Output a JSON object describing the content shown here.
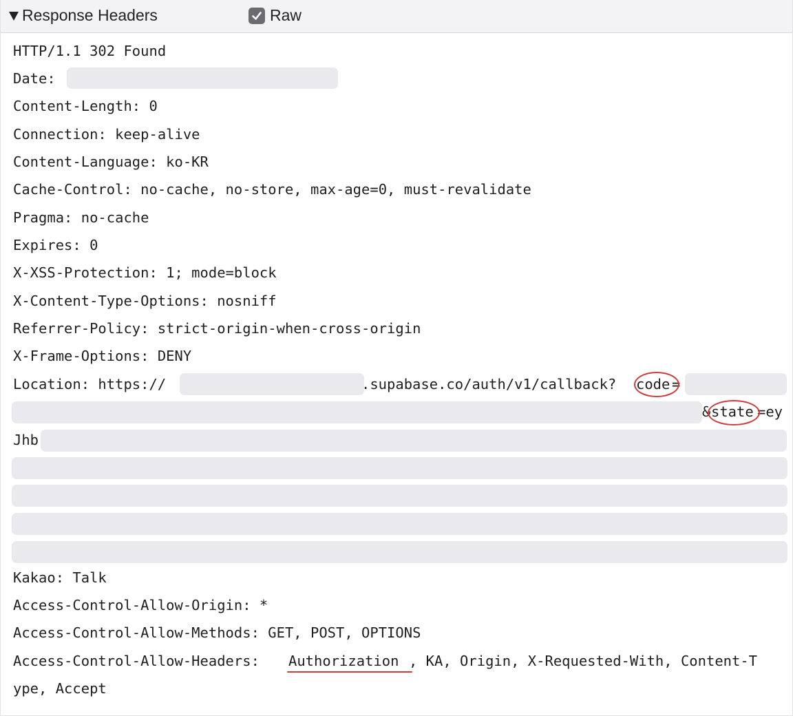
{
  "section": {
    "title": "Response Headers",
    "raw_label": "Raw",
    "raw_checked": true
  },
  "headers": {
    "status": "HTTP/1.1 302 Found",
    "date": "Date:",
    "content_length": "Content-Length: 0",
    "connection": "Connection: keep-alive",
    "content_language": "Content-Language: ko-KR",
    "cache_control": "Cache-Control: no-cache, no-store, max-age=0, must-revalidate",
    "pragma": "Pragma: no-cache",
    "expires": "Expires: 0",
    "x_xss": "X-XSS-Protection: 1; mode=block",
    "x_content_type": "X-Content-Type-Options: nosniff",
    "referrer_policy": "Referrer-Policy: strict-origin-when-cross-origin",
    "x_frame": "X-Frame-Options: DENY",
    "location_prefix": "Location: https://",
    "location_domain": ".supabase.co/auth/v1/callback?",
    "location_code": "code",
    "location_eq": "=",
    "location_amp": "&",
    "location_state": "state",
    "location_state_tail": "=ey",
    "location_cont": "Jhb",
    "kakao": "Kakao: Talk",
    "acao": "Access-Control-Allow-Origin: *",
    "acam": "Access-Control-Allow-Methods: GET, POST, OPTIONS",
    "acah_prefix": "Access-Control-Allow-Headers: ",
    "acah_authorization": "Authorization",
    "acah_rest": ", KA, Origin, X-Requested-With, Content-T",
    "acah_cont": "ype, Accept"
  },
  "annotations": {
    "color": "#d23a3a"
  },
  "colors": {
    "redaction": "#e9e9ee",
    "header_bar": "#f3f3f6",
    "checkbox": "#6b6b70"
  }
}
